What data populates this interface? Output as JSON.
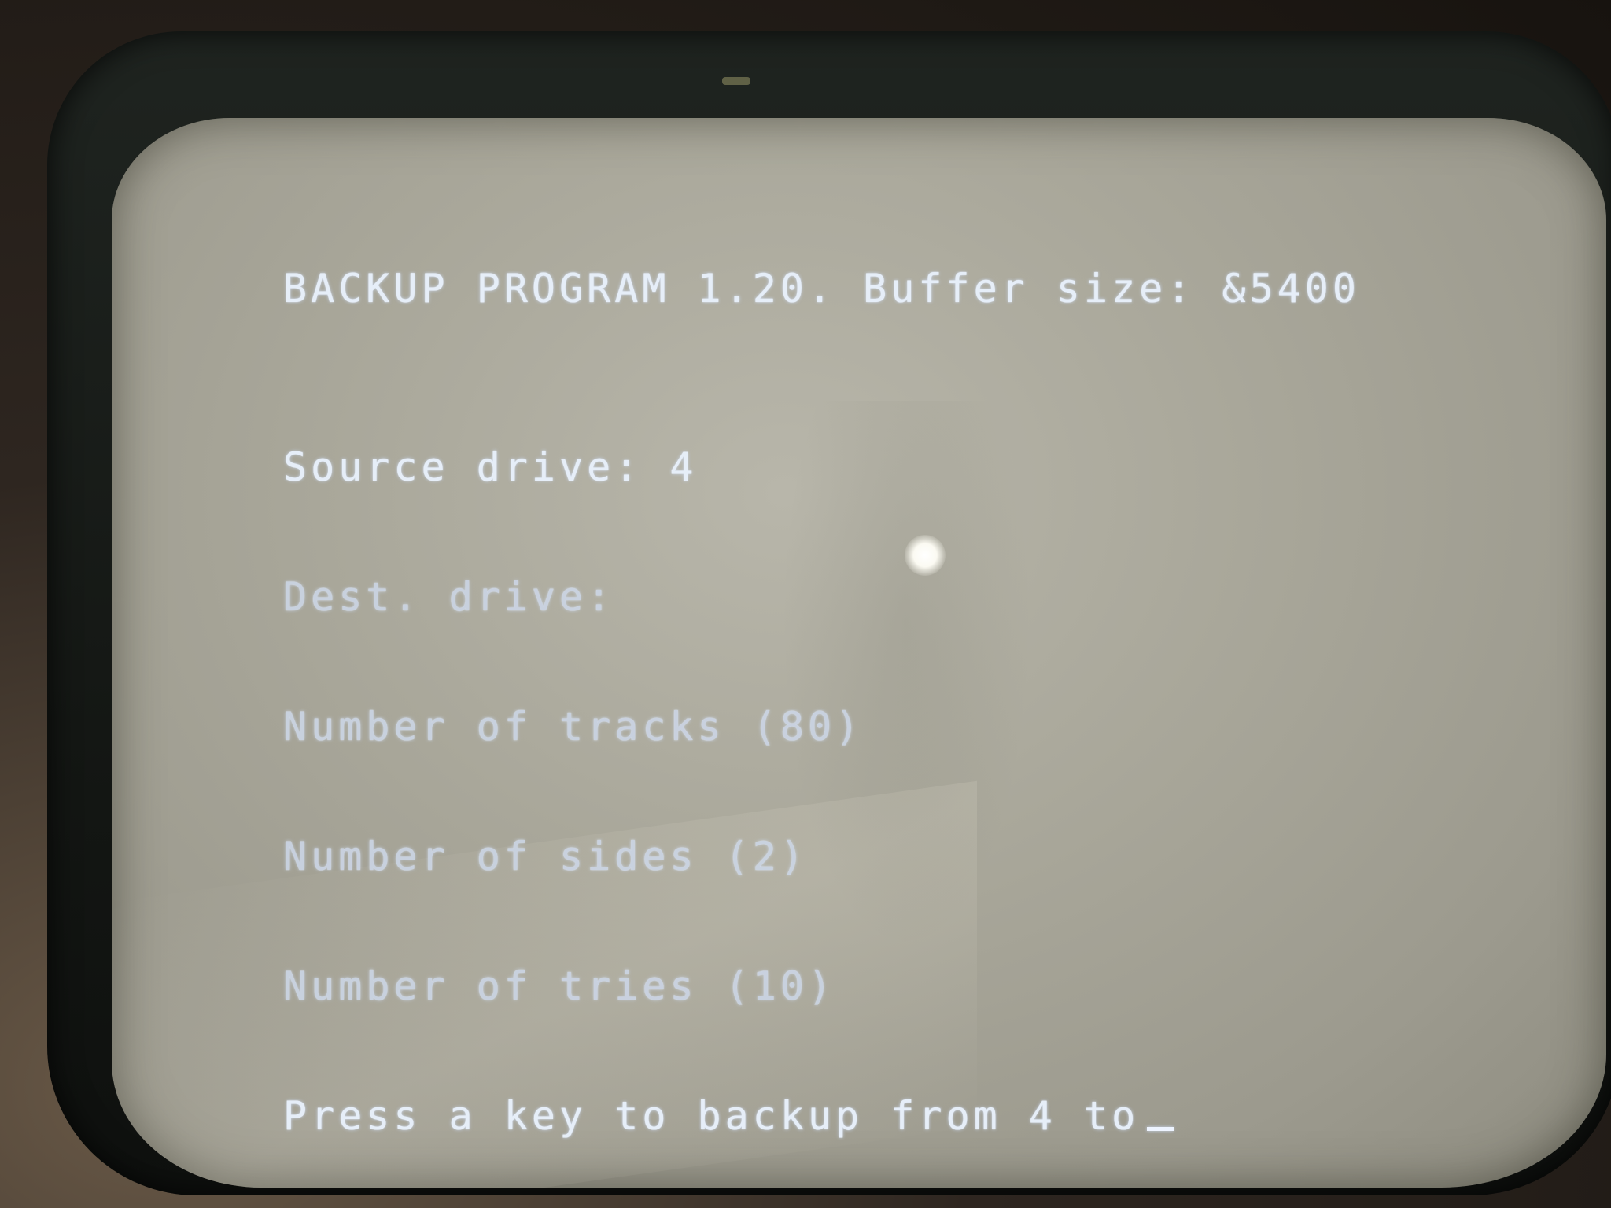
{
  "screen": {
    "title_line": "BACKUP PROGRAM 1.20. Buffer size: &5400",
    "lines": [
      "Source drive: 4",
      "Dest. drive:",
      "Number of tracks (80)",
      "Number of sides (2)",
      "Number of tries (10)",
      "Press a key to backup from 4 to"
    ]
  },
  "colors": {
    "screen_background": "#a9a79a",
    "text": "#e6eef8",
    "bezel": "#1f2420"
  }
}
